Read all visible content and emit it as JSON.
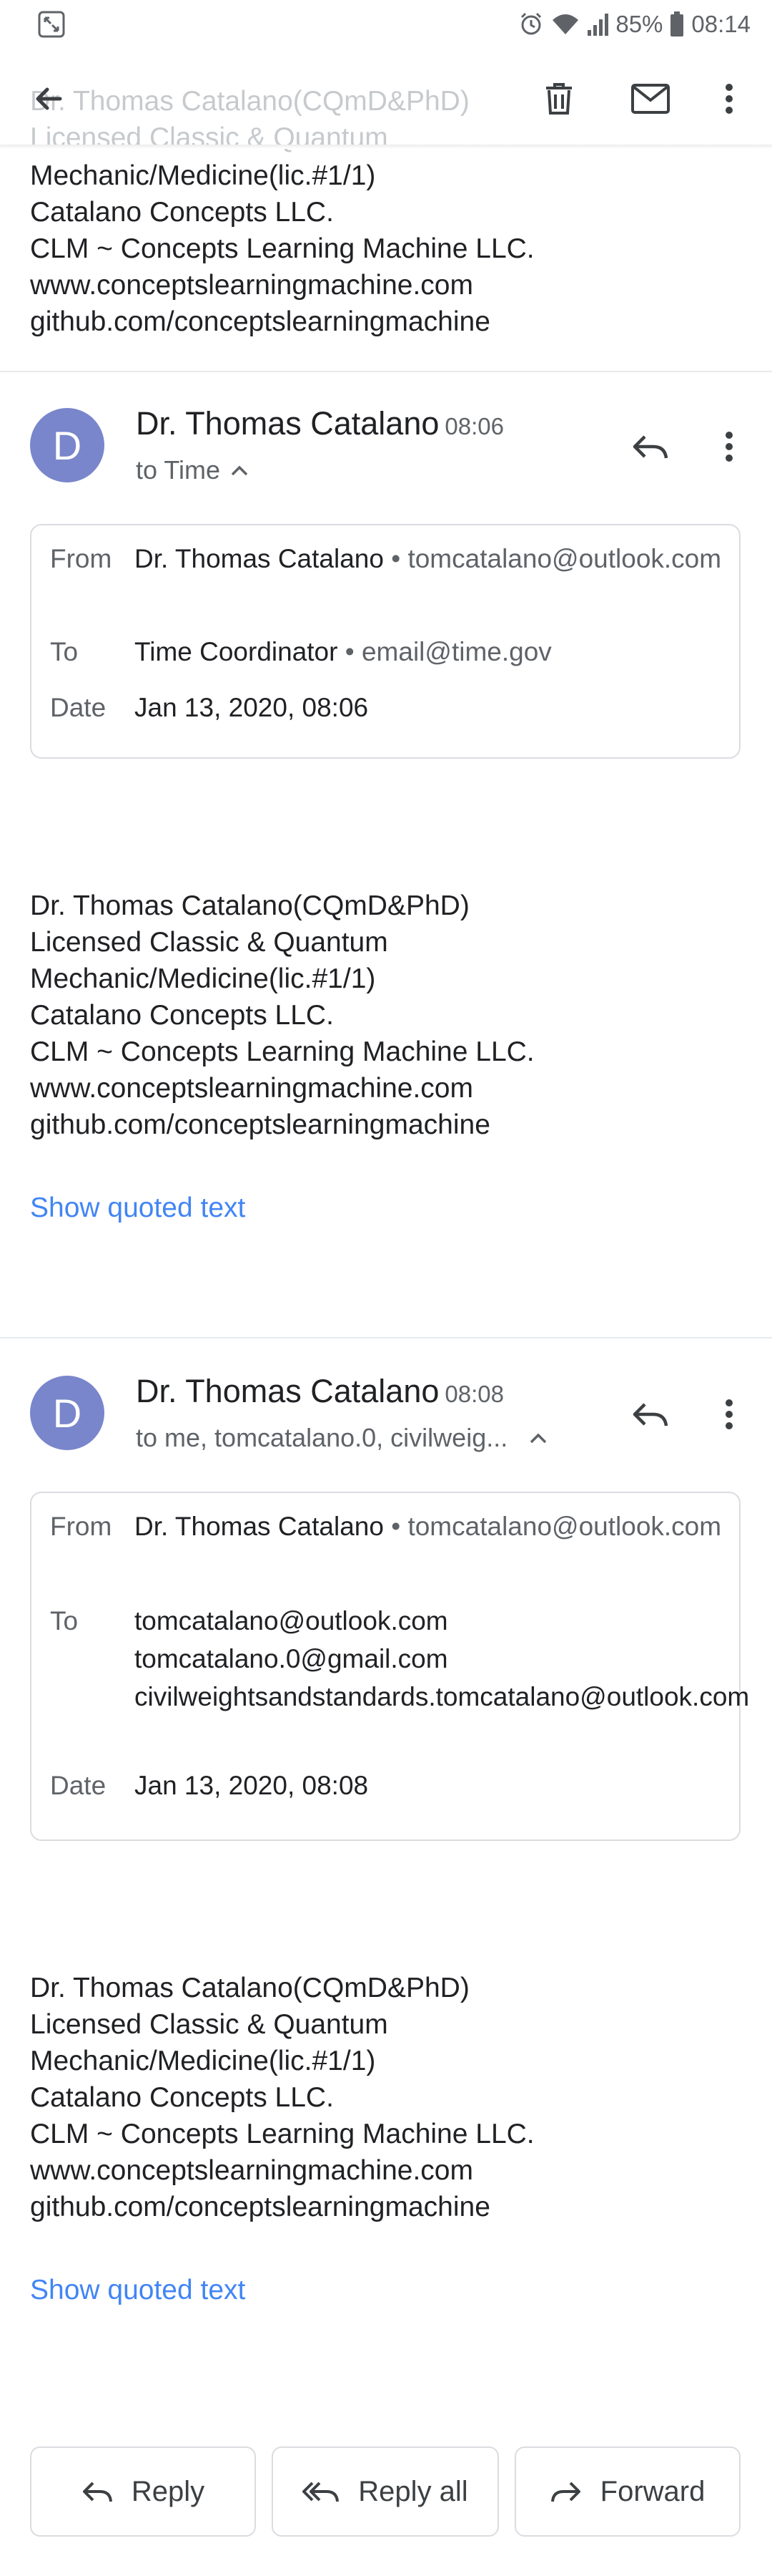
{
  "status_bar": {
    "battery": "85%",
    "time": "08:14"
  },
  "signature_lines": [
    "Dr. Thomas Catalano(CQmD&PhD)",
    "Licensed Classic & Quantum",
    "Mechanic/Medicine(lic.#1/1)",
    "Catalano Concepts LLC.",
    "CLM ~ Concepts Learning Machine LLC.",
    "www.conceptslearningmachine.com",
    "github.com/conceptslearningmachine"
  ],
  "messages": [
    {
      "sender": "Dr. Thomas Catalano",
      "time": "08:06",
      "avatar_letter": "D",
      "recipients_summary": "to Time",
      "details": {
        "from_label": "From",
        "from_name": "Dr. Thomas Catalano",
        "from_email": "tomcatalano@outlook.com",
        "to_label": "To",
        "to_name": "Time Coordinator",
        "to_email": "email@time.gov",
        "date_label": "Date",
        "date": "Jan 13, 2020, 08:06"
      },
      "show_quoted": "Show quoted text"
    },
    {
      "sender": "Dr. Thomas Catalano",
      "time": "08:08",
      "avatar_letter": "D",
      "recipients_summary": "to me, tomcatalano.0, civilweig...",
      "details": {
        "from_label": "From",
        "from_name": "Dr. Thomas Catalano",
        "from_email": "tomcatalano@outlook.com",
        "to_label": "To",
        "to_list": [
          "tomcatalano@outlook.com",
          "tomcatalano.0@gmail.com",
          "civilweightsandstandards.tomcatalano@outlook.com"
        ],
        "date_label": "Date",
        "date": "Jan 13, 2020, 08:08"
      },
      "show_quoted": "Show quoted text"
    }
  ],
  "actions": {
    "reply": "Reply",
    "reply_all": "Reply all",
    "forward": "Forward"
  },
  "colors": {
    "avatar": "#7986cb",
    "link": "#4285f4"
  }
}
